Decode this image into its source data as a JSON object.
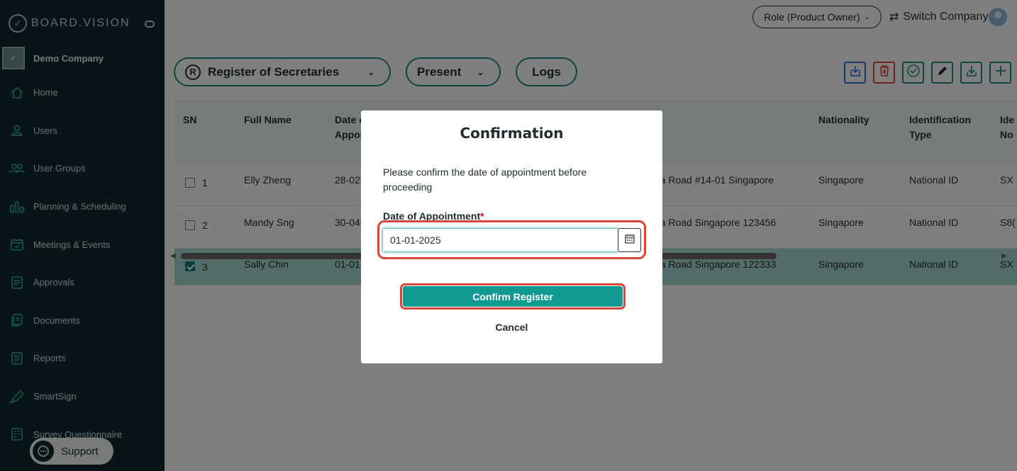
{
  "brand": {
    "name": "BOARD.VISION",
    "logo_icon": "swoosh-logo"
  },
  "company": {
    "name": "Demo Company"
  },
  "sidebar": {
    "items": [
      {
        "label": "Home",
        "icon": "home-icon"
      },
      {
        "label": "Users",
        "icon": "user-icon"
      },
      {
        "label": "User Groups",
        "icon": "user-group-icon"
      },
      {
        "label": "Planning & Scheduling",
        "icon": "bar-chart-icon"
      },
      {
        "label": "Meetings & Events",
        "icon": "calendar-icon"
      },
      {
        "label": "Approvals",
        "icon": "approval-icon"
      },
      {
        "label": "Documents",
        "icon": "documents-icon"
      },
      {
        "label": "Reports",
        "icon": "report-icon"
      },
      {
        "label": "SmartSign",
        "icon": "pen-icon"
      },
      {
        "label": "Survey Questionnaire",
        "icon": "survey-icon"
      }
    ]
  },
  "support": {
    "label": "Support"
  },
  "topbar": {
    "role": "Role (Product Owner)",
    "switch_company": "Switch Company"
  },
  "filters": {
    "register_icon": "R",
    "register": "Register of Secretaries",
    "period": "Present",
    "logs": "Logs"
  },
  "toolbar": {
    "buttons": [
      "import-icon",
      "trash-icon",
      "check-circle-icon",
      "pencil-icon",
      "download-icon",
      "plus-icon"
    ]
  },
  "table": {
    "headers": {
      "sn": "SN",
      "full_name": "Full Name",
      "date_line1": "Date o",
      "date_line2": "Appoi",
      "nationality": "Nationality",
      "id_type_line1": "Identification",
      "id_type_line2": "Type",
      "id_no_line1": "Ide",
      "id_no_line2": "No"
    },
    "rows": [
      {
        "sn": "1",
        "name": "Elly Zheng",
        "date": "28-02-",
        "address": "ra Road #14-01 Singapore",
        "nationality": "Singapore",
        "id_type": "National ID",
        "id_no": "SX",
        "checked": false
      },
      {
        "sn": "2",
        "name": "Mandy Sng",
        "date": "30-04-",
        "address": "ra Road Singapore 123456",
        "nationality": "Singapore",
        "id_type": "National ID",
        "id_no": "S8(",
        "checked": false
      },
      {
        "sn": "3",
        "name": "Sally Chin",
        "date": "01-01-",
        "address": "ra Road Singapore 122333",
        "nationality": "Singapore",
        "id_type": "National ID",
        "id_no": "SX",
        "checked": true
      }
    ]
  },
  "modal": {
    "title": "Confirmation",
    "message": "Please confirm the date of appointment before proceeding",
    "date_label": "Date of Appointment",
    "required_mark": "*",
    "date_value": "01-01-2025",
    "confirm_label": "Confirm Register",
    "cancel_label": "Cancel"
  },
  "colors": {
    "accent": "#129a92",
    "sidebar": "#0e2a30",
    "highlight": "#d8453a",
    "selected_row": "#a6d6d2"
  }
}
